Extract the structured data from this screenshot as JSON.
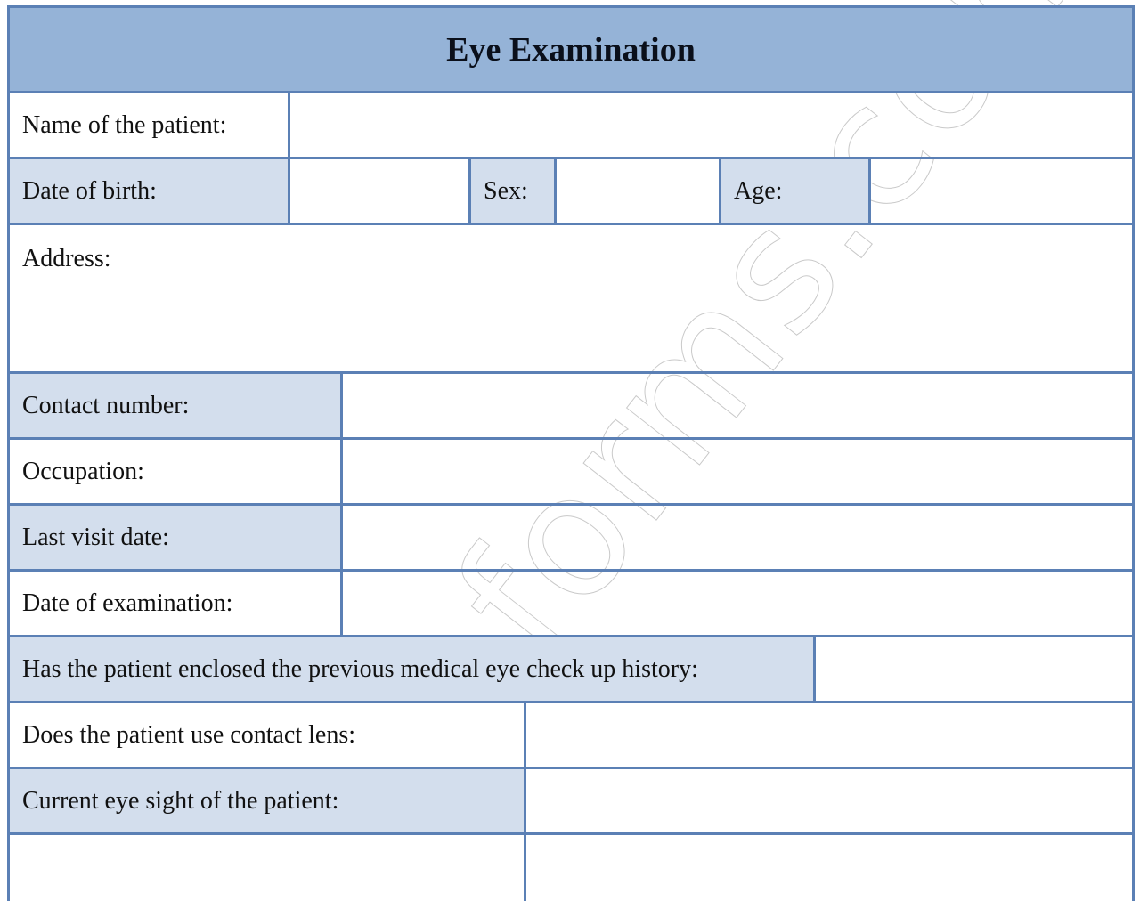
{
  "form": {
    "title": "Eye Examination",
    "fields": {
      "patient_name": {
        "label": "Name of the patient:",
        "value": ""
      },
      "date_of_birth": {
        "label": "Date of birth:",
        "value": ""
      },
      "sex": {
        "label": "Sex:",
        "value": ""
      },
      "age": {
        "label": "Age:",
        "value": ""
      },
      "address": {
        "label": "Address:",
        "value": ""
      },
      "contact_number": {
        "label": "Contact number:",
        "value": ""
      },
      "occupation": {
        "label": "Occupation:",
        "value": ""
      },
      "last_visit_date": {
        "label": "Last visit date:",
        "value": ""
      },
      "date_of_examination": {
        "label": "Date of examination:",
        "value": ""
      },
      "previous_history": {
        "label": "Has the patient enclosed the previous medical eye check up history:",
        "value": ""
      },
      "contact_lens": {
        "label": "Does the patient use contact lens:",
        "value": ""
      },
      "current_eyesight": {
        "label": "Current eye sight of the patient:",
        "value": ""
      }
    }
  },
  "watermark": "forms.com",
  "colors": {
    "header_bg": "#95b3d7",
    "shaded_bg": "#d3deed",
    "border": "#5b80b5"
  }
}
